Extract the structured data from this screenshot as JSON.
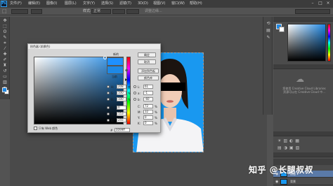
{
  "app": {
    "logo": "Ps"
  },
  "menu": [
    "文件(F)",
    "编辑(E)",
    "图像(I)",
    "图层(L)",
    "文字(Y)",
    "选择(S)",
    "滤镜(T)",
    "3D(D)",
    "视图(V)",
    "窗口(W)",
    "帮助(H)"
  ],
  "options_bar": {
    "style_label": "样式:",
    "style_value": "正常",
    "refine_edge": "调整边缘..."
  },
  "color_picker": {
    "title": "拾色器 (前景色)",
    "new_label": "新的",
    "current_label": "当前",
    "ok_label": "确定",
    "cancel_label": "取消",
    "add_swatch_label": "添加到色板",
    "libraries_label": "颜色库",
    "web_only_label": "只有 Web 颜色",
    "hsb": [
      {
        "label": "H:",
        "value": "208",
        "unit": "度"
      },
      {
        "label": "S:",
        "value": "100",
        "unit": "%"
      },
      {
        "label": "B:",
        "value": "100",
        "unit": "%"
      }
    ],
    "rgb": [
      {
        "label": "R:",
        "value": "0"
      },
      {
        "label": "G:",
        "value": "153"
      },
      {
        "label": "B:",
        "value": "255"
      }
    ],
    "lab": [
      {
        "label": "L:",
        "value": "61"
      },
      {
        "label": "a:",
        "value": "-1"
      },
      {
        "label": "b:",
        "value": "-60"
      }
    ],
    "cmyk": [
      {
        "label": "C:",
        "value": "72",
        "unit": "%"
      },
      {
        "label": "M:",
        "value": "32",
        "unit": "%"
      },
      {
        "label": "Y:",
        "value": "0",
        "unit": "%"
      },
      {
        "label": "K:",
        "value": "0",
        "unit": "%"
      }
    ],
    "hex_label": "#",
    "hex_value": "0099ff",
    "new_color": "#1e90ff",
    "current_color": "#1e88e5"
  },
  "right_panel": {
    "cc_lines": [
      "您使用 Creative Cloud Libraries",
      "资源可以在 Creative Cloud 中..."
    ],
    "cc_link": "立即 Libraries",
    "layers": [
      {
        "name": "图层 1"
      },
      {
        "name": "背景"
      }
    ]
  },
  "watermark": "知乎 @长腿叔叔",
  "colors": {
    "accent": "#1e88e5",
    "photo_bg": "#1998f0"
  }
}
